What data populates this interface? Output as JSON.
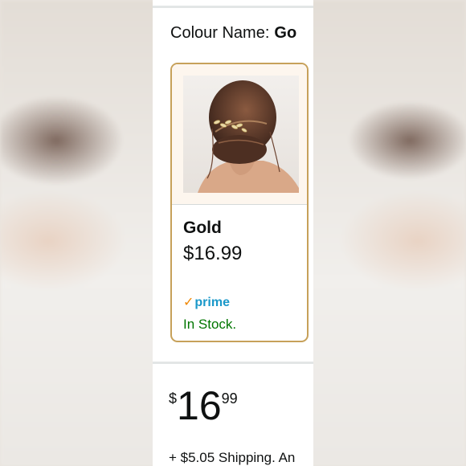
{
  "colour": {
    "label": "Colour Name:",
    "value": "Go"
  },
  "swatch": {
    "name": "Gold",
    "price": "$16.99",
    "prime_label": "prime",
    "stock": "In Stock."
  },
  "buy_box": {
    "currency": "$",
    "price_whole": "16",
    "price_fraction": "99",
    "shipping": "+ $5.05 Shipping. An"
  },
  "colors": {
    "selected_border": "#c7a15a",
    "prime_blue": "#1a98c9",
    "prime_check": "#f08804",
    "in_stock_green": "#007600"
  }
}
